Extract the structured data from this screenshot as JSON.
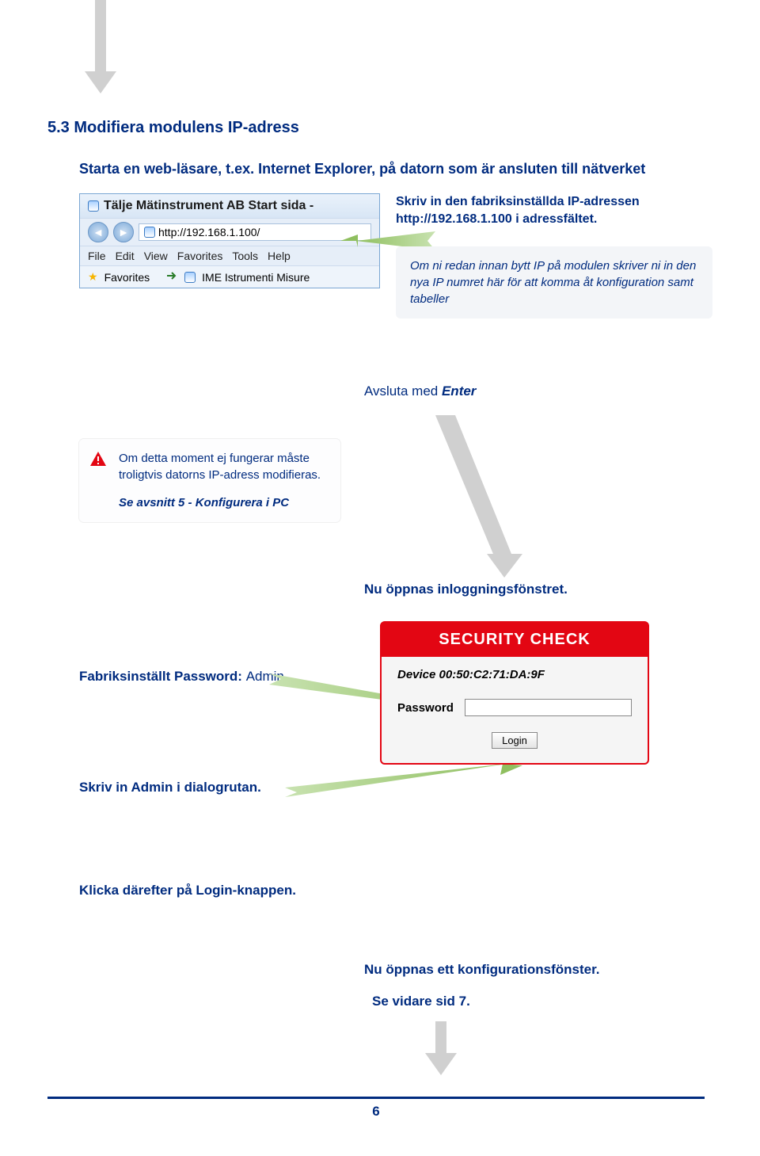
{
  "heading": "5.3  Modifiera modulens IP-adress",
  "intro": "Starta en web-läsare, t.ex. Internet Explorer, på datorn som är ansluten till nätverket",
  "browser": {
    "title": "Tälje Mätinstrument AB Start sida -",
    "url": "http://192.168.1.100/",
    "menu": {
      "file": "File",
      "edit": "Edit",
      "view": "View",
      "fav": "Favorites",
      "tools": "Tools",
      "help": "Help"
    },
    "favorites": "Favorites",
    "tab": "IME Istrumenti Misure "
  },
  "info1": "Skriv in den fabriksinställda IP-adressen http://192.168.1.100  i adressfältet.",
  "tip": "Om ni redan innan bytt IP på modulen skriver ni in den nya IP numret här för att komma åt konfiguration samt tabeller",
  "enter": {
    "a": "Avsluta med ",
    "b": "Enter"
  },
  "warn": {
    "line1": "Om detta moment  ej fungerar måste  troligtvis datorns IP-adress modifieras.",
    "line2": "Se avsnitt 5 - Konfigurera i PC"
  },
  "loginOpens": "Nu öppnas inloggningsfönstret.",
  "pw": {
    "pre": "Fabriksinställt Password:  ",
    "val": "Admin"
  },
  "adminLine": "Skriv in Admin i dialogrutan.",
  "clickLogin": "Klicka därefter på  Login-knappen.",
  "dialog": {
    "title": "SECURITY CHECK",
    "device": "Device 00:50:C2:71:DA:9F",
    "pwLabel": "Password",
    "login": "Login"
  },
  "cfgOpens": "Nu öppnas ett konfigurationsfönster.",
  "seeSid7": "Se vidare sid 7.",
  "pageNum": "6"
}
